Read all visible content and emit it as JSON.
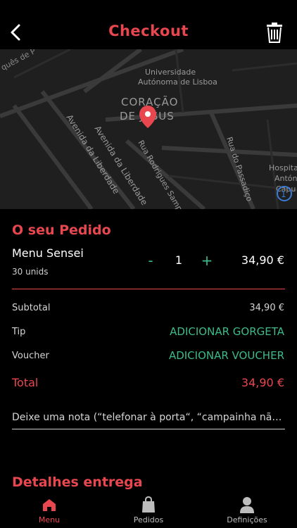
{
  "header": {
    "title": "Checkout",
    "back_icon": "chevron-left-icon",
    "trash_icon": "trash-icon"
  },
  "map": {
    "labels": {
      "district": "CORAÇÃO DE JESUS",
      "university": "Universidade Autónoma de Lisboa",
      "avenida_liberdade": "Avenida da Liberdade",
      "avenida_liberdade_short": "Avenida da Liberdade",
      "rua_rodrigues": "Rua Rodrigues Sampaio",
      "rua_passadico": "Rua do Passadiço",
      "hospital": "Hospital",
      "antonio": "Antón",
      "top_left": "quês de P",
      "capu": "Capu"
    },
    "pin_icon": "location-pin-icon"
  },
  "order": {
    "section_title": "O seu Pedido",
    "item": {
      "name": "Menu Sensei",
      "units": "30 unids",
      "quantity": "1",
      "minus": "-",
      "plus": "+",
      "price": "34,90 €"
    },
    "subtotal_label": "Subtotal",
    "subtotal_value": "34,90 €",
    "tip_label": "Tip",
    "tip_action": "ADICIONAR GORGETA",
    "voucher_label": "Voucher",
    "voucher_action": "ADICIONAR VOUCHER",
    "total_label": "Total",
    "total_value": "34,90 €",
    "note_placeholder": "Deixe uma nota (“telefonar à porta“, “campainha não funciona“)"
  },
  "delivery": {
    "section_title": "Detalhes entrega"
  },
  "nav": {
    "items": [
      {
        "label": "Menu",
        "icon": "home-icon",
        "active": true
      },
      {
        "label": "Pedidos",
        "icon": "shopping-bag-icon",
        "active": false
      },
      {
        "label": "Definições",
        "icon": "user-icon",
        "active": false
      }
    ]
  },
  "colors": {
    "accent": "#e8474f",
    "green": "#3dbb8a",
    "background": "#000000",
    "map": "#1f1f1f"
  }
}
